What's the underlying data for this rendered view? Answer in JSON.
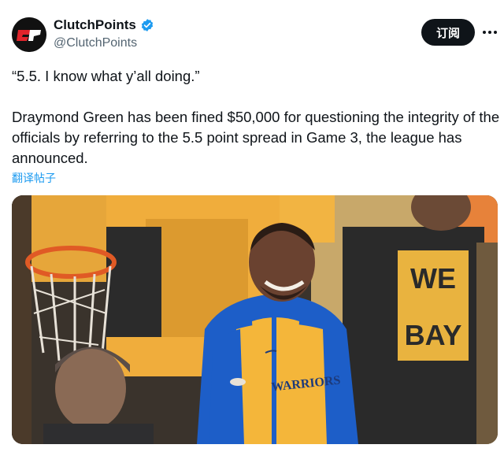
{
  "account": {
    "display_name": "ClutchPoints",
    "handle": "@ClutchPoints",
    "avatar_text": "CP",
    "verified": true
  },
  "actions": {
    "subscribe_label": "订阅",
    "more_icon": "more-horizontal-icon"
  },
  "tweet": {
    "quote": "“5.5. I know what y’all doing.”",
    "body": "Draymond Green has been fined $50,000 for questioning the integrity of the officials by referring to the 5.5 point spread in Game 3, the league has announced.",
    "translate_label": "翻译帖子"
  },
  "media": {
    "jersey_text": "WARRIORS",
    "shirt_text_top": "WE",
    "shirt_text_bottom": "BAY"
  },
  "colors": {
    "accent": "#1d9bf0",
    "text": "#0f1419",
    "secondary": "#536471",
    "warriors_blue": "#1d5ec8",
    "warriors_gold": "#f4b63a"
  }
}
